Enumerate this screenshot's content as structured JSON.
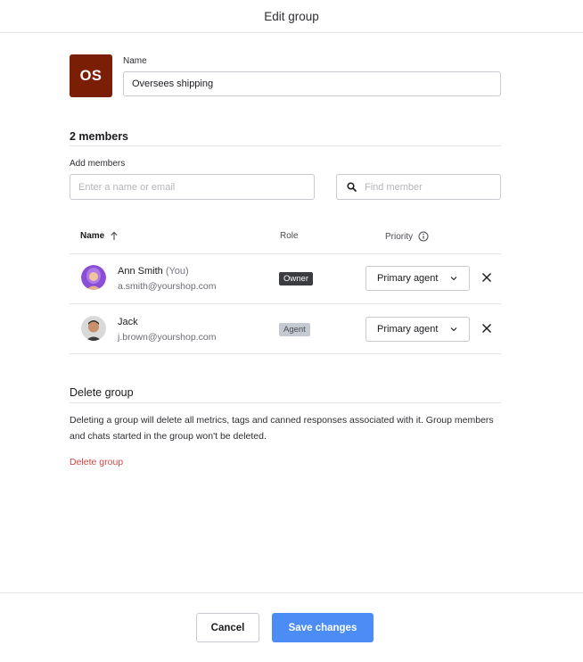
{
  "header": {
    "title": "Edit group"
  },
  "group": {
    "initials": "OS",
    "avatar_color": "#7a1e06",
    "name_label": "Name",
    "name_value": "Oversees shipping"
  },
  "members_section": {
    "title": "2 members",
    "add_label": "Add members",
    "add_placeholder": "Enter a name or email",
    "find_placeholder": "Find member",
    "columns": {
      "name": "Name",
      "role": "Role",
      "priority": "Priority"
    },
    "members": [
      {
        "name": "Ann Smith",
        "suffix": "(You)",
        "email": "a.smith@yourshop.com",
        "role": "Owner",
        "priority": "Primary agent"
      },
      {
        "name": "Jack",
        "suffix": "",
        "email": "j.brown@yourshop.com",
        "role": "Agent",
        "priority": "Primary agent"
      }
    ]
  },
  "delete_section": {
    "title": "Delete group",
    "description": "Deleting a group will delete all metrics, tags and canned responses associated with it. Group members and chats started in the group won't be deleted.",
    "link": "Delete group"
  },
  "footer": {
    "cancel_label": "Cancel",
    "save_label": "Save changes"
  },
  "icons": {
    "sort": "arrow-up-icon",
    "info": "info-icon",
    "search": "search-icon",
    "chevron": "chevron-down-icon",
    "remove": "close-icon"
  },
  "colors": {
    "accent": "#4b8cf5",
    "danger": "#d64646",
    "owner_badge": "#3a3c40",
    "agent_badge": "#c5cad2"
  }
}
